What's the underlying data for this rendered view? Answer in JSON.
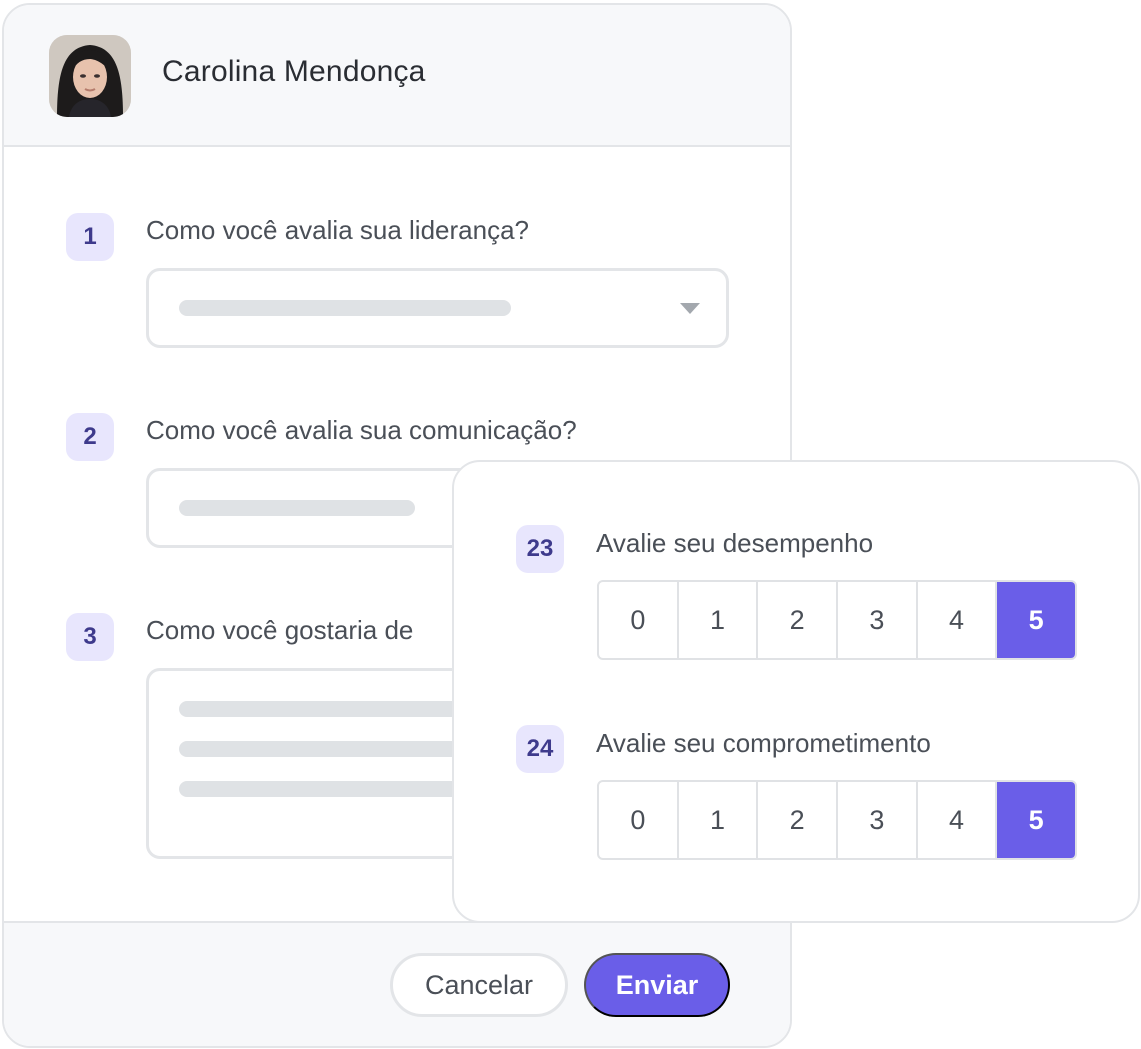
{
  "user": {
    "name": "Carolina Mendonça"
  },
  "questions": [
    {
      "number": "1",
      "text": "Como você avalia sua liderança?"
    },
    {
      "number": "2",
      "text": "Como você avalia sua comunicação?"
    },
    {
      "number": "3",
      "text": "Como você gostaria de"
    }
  ],
  "ratings": [
    {
      "number": "23",
      "text": "Avalie seu desempenho",
      "options": [
        "0",
        "1",
        "2",
        "3",
        "4",
        "5"
      ],
      "selected": "5"
    },
    {
      "number": "24",
      "text": "Avalie seu comprometimento",
      "options": [
        "0",
        "1",
        "2",
        "3",
        "4",
        "5"
      ],
      "selected": "5"
    }
  ],
  "footer": {
    "cancel_label": "Cancelar",
    "submit_label": "Enviar"
  },
  "colors": {
    "accent": "#6a5ee8",
    "badge_bg": "#e8e6fd",
    "badge_text": "#3e3a8c",
    "border": "#e3e5e8",
    "placeholder_bar": "#dfe2e5"
  },
  "icons": {
    "dropdown": "caret-down-icon"
  }
}
